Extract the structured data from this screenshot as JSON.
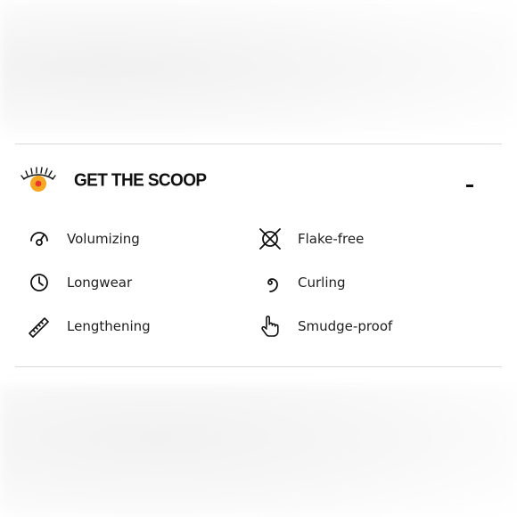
{
  "section": {
    "title": "GET THE SCOOP",
    "collapse_label": "-"
  },
  "features": [
    {
      "label": "Volumizing",
      "icon": "gauge-icon"
    },
    {
      "label": "Flake-free",
      "icon": "crossed-circle-icon"
    },
    {
      "label": "Longwear",
      "icon": "clock-icon"
    },
    {
      "label": "Curling",
      "icon": "spiral-icon"
    },
    {
      "label": "Lengthening",
      "icon": "ruler-icon"
    },
    {
      "label": "Smudge-proof",
      "icon": "pointing-hand-icon"
    }
  ],
  "colors": {
    "eye_iris": "#f5a623",
    "eye_pupil": "#e8382c",
    "divider": "#d9d9d9",
    "text": "#1a1a1a"
  }
}
